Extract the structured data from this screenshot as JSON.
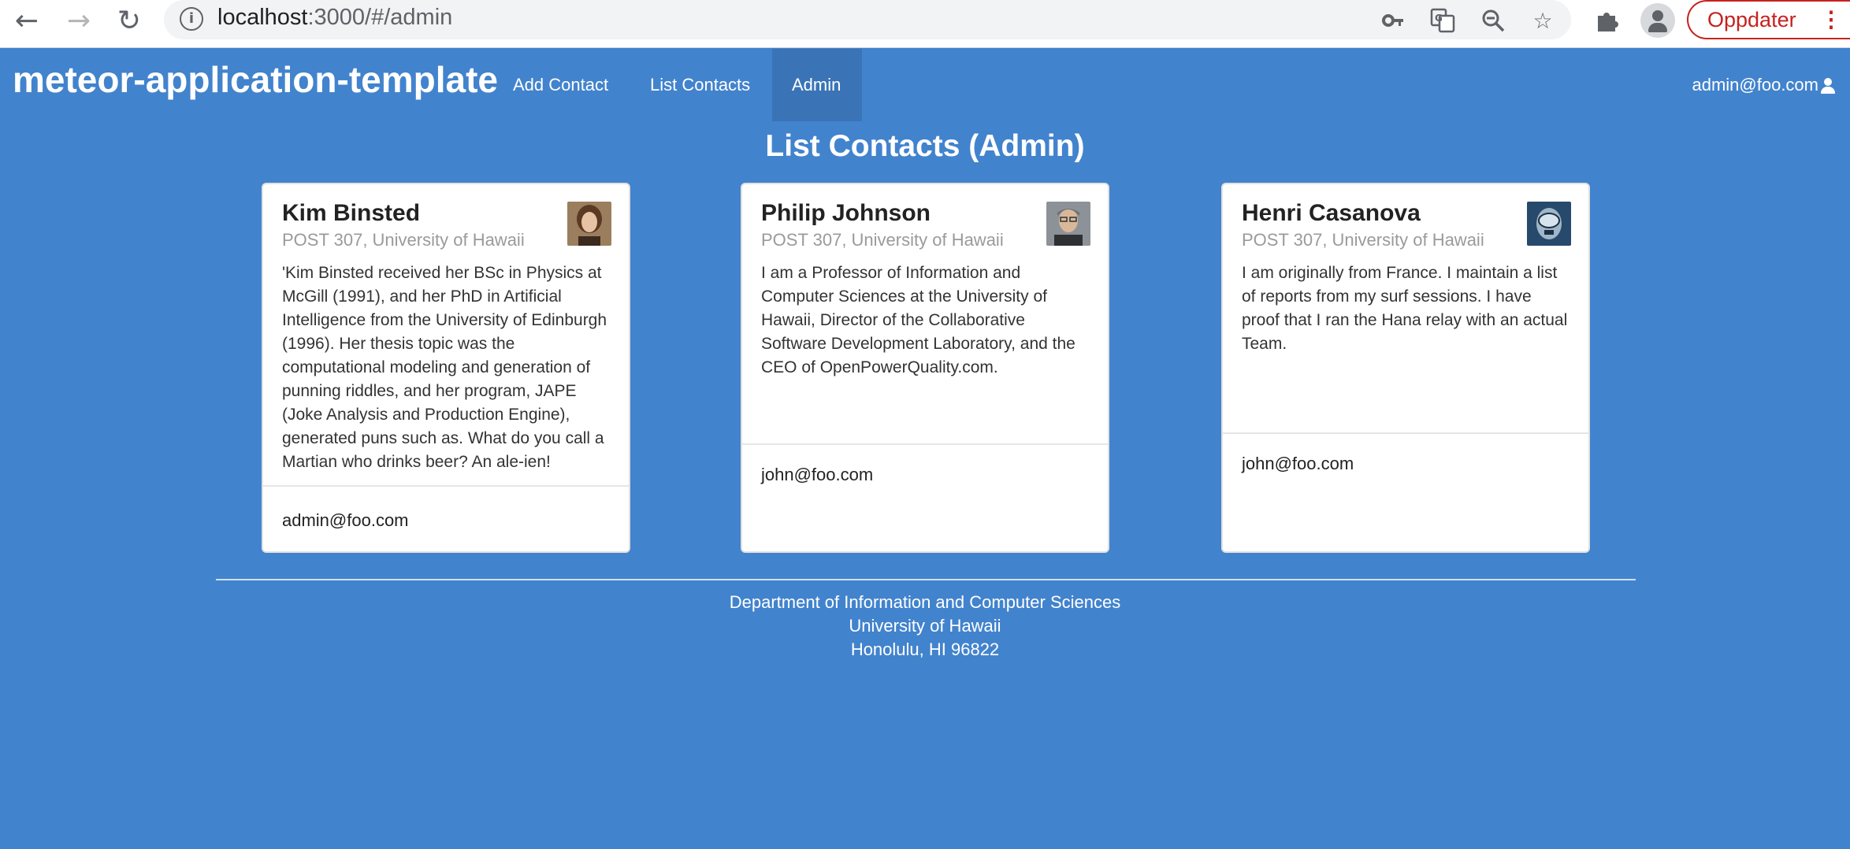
{
  "browser": {
    "url_host": "localhost",
    "url_rest": ":3000/#/admin",
    "update_label": "Oppdater",
    "icons": [
      "back-icon",
      "forward-icon",
      "reload-icon",
      "info-icon",
      "key-icon",
      "translate-icon",
      "zoom-out-icon",
      "star-icon",
      "extensions-icon",
      "profile-icon",
      "menu-icon"
    ]
  },
  "navbar": {
    "brand": "meteor-application-template",
    "links": [
      "Add Contact",
      "List Contacts",
      "Admin"
    ],
    "active": "Admin",
    "user": "admin@foo.com"
  },
  "page": {
    "title": "List Contacts (Admin)"
  },
  "contacts": [
    {
      "name": "Kim Binsted",
      "address": "POST 307, University of Hawaii",
      "description": "'Kim Binsted received her BSc in Physics at McGill (1991), and her PhD in Artificial Intelligence from the University of Edinburgh (1996). Her thesis topic was the computational modeling and generation of punning riddles, and her program, JAPE (Joke Analysis and Production Engine), generated puns such as. What do you call a Martian who drinks beer? An ale-ien!",
      "owner": "admin@foo.com"
    },
    {
      "name": "Philip Johnson",
      "address": "POST 307, University of Hawaii",
      "description": "I am a Professor of Information and Computer Sciences at the University of Hawaii, Director of the Collaborative Software Development Laboratory, and the CEO of OpenPowerQuality.com.",
      "owner": "john@foo.com"
    },
    {
      "name": "Henri Casanova",
      "address": "POST 307, University of Hawaii",
      "description": "I am originally from France. I maintain a list of reports from my surf sessions. I have proof that I ran the Hana relay with an actual Team.",
      "owner": "john@foo.com"
    }
  ],
  "footer": {
    "line1": "Department of Information and Computer Sciences",
    "line2": "University of Hawaii",
    "line3": "Honolulu, HI 96822"
  },
  "colors": {
    "background": "#4283CD",
    "nav_active": "#3A74B6",
    "update_red": "#c5221f"
  }
}
